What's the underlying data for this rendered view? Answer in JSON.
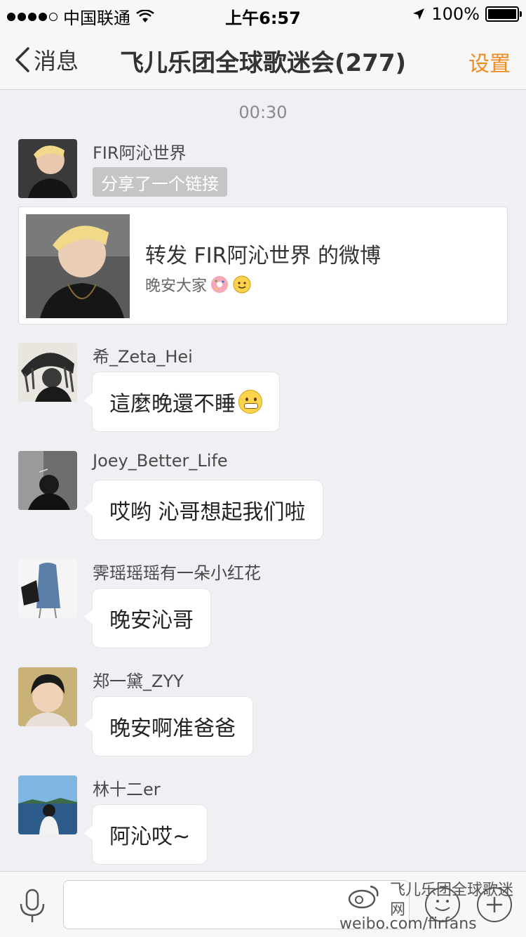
{
  "status_bar": {
    "carrier": "中国联通",
    "time": "上午6:57",
    "battery_text": "100%"
  },
  "nav": {
    "back_label": "消息",
    "title": "飞儿乐团全球歌迷会(277)",
    "settings_label": "设置"
  },
  "chat": {
    "timestamp": "00:30",
    "messages": [
      {
        "sender": "FIR阿沁世界",
        "share_tag": "分享了一个链接",
        "share_title": "转发 FIR阿沁世界 的微博",
        "share_subtitle": "晚安大家"
      },
      {
        "sender": "希_Zeta_Hei",
        "text": "這麼晚還不睡"
      },
      {
        "sender": "Joey_Better_Life",
        "text": "哎哟 沁哥想起我们啦"
      },
      {
        "sender": "霁瑶瑶瑶有一朵小红花",
        "text": "晚安沁哥"
      },
      {
        "sender": "郑一黛_ZYY",
        "text": "晚安啊准爸爸"
      },
      {
        "sender": "林十二er",
        "text": "阿沁哎~"
      }
    ]
  },
  "watermark": {
    "line1": "飞儿乐团全球歌迷网",
    "line2": "weibo.com/firfans"
  },
  "colors": {
    "accent": "#f08c1f",
    "background": "#efeff4",
    "share_tag_bg": "#c5c5c5"
  },
  "icons": [
    "signal-dots-icon",
    "wifi-icon",
    "location-arrow-icon",
    "battery-icon",
    "back-chevron-icon",
    "microphone-icon",
    "emoji-icon",
    "plus-icon",
    "weibo-logo-icon"
  ]
}
